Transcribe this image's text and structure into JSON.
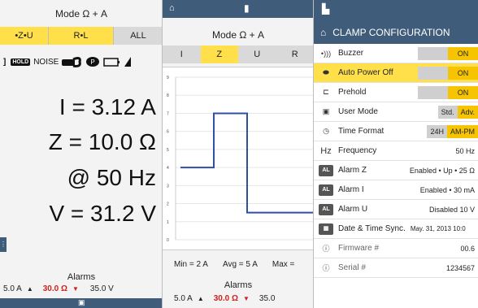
{
  "screen1": {
    "mode": "Mode  Ω + A",
    "tabs": [
      "•Z•U",
      "R•L",
      "ALL"
    ],
    "indicators": {
      "hold": "HOLD",
      "noise": "NOISE"
    },
    "measurements": [
      {
        "text": "I = 3.12 A"
      },
      {
        "text": "Z = 10.0 Ω"
      },
      {
        "text": "@  50 Hz"
      },
      {
        "text": "V =  31.2 V"
      }
    ],
    "alarms_label": "Alarms",
    "alarms": {
      "left": "5.0 A",
      "mid": "30.0 Ω",
      "right": "35.0 V"
    }
  },
  "screen2": {
    "mode": "Mode  Ω + A",
    "tabs": [
      "I",
      "Z",
      "U",
      "R"
    ],
    "stats": {
      "min": "Min = 2 A",
      "avg": "Avg = 5 A",
      "max": "Max ="
    },
    "alarms_label": "Alarms",
    "alarms": {
      "left": "5.0 A",
      "mid": "30.0 Ω",
      "right": "35.0"
    },
    "y_ticks": [
      "0",
      "1",
      "2",
      "3",
      "4",
      "5",
      "6",
      "7",
      "8",
      "9"
    ]
  },
  "chart_data": {
    "type": "line",
    "ylim": [
      0,
      9
    ],
    "x": [
      0,
      1,
      1,
      2,
      2,
      4
    ],
    "y": [
      4,
      4,
      7,
      7,
      1.5,
      1.5
    ]
  },
  "screen3": {
    "title": "CLAMP CONFIGURATION",
    "rows": [
      {
        "label": "Buzzer",
        "value": "ON"
      },
      {
        "label": "Auto Power Off",
        "value": "ON"
      },
      {
        "label": "Prehold",
        "value": "ON"
      },
      {
        "label": "User Mode",
        "opt1": "Std.",
        "opt2": "Adv."
      },
      {
        "label": "Time Format",
        "opt1": "24H",
        "opt2": "AM-PM"
      },
      {
        "label": "Frequency",
        "value": "50 Hz"
      },
      {
        "label": "Alarm Z",
        "value": "Enabled • Up • 25 Ω"
      },
      {
        "label": "Alarm I",
        "value": "Enabled • 30 mA"
      },
      {
        "label": "Alarm U",
        "value": "Disabled 10 V"
      },
      {
        "label": "Date & Time Sync.",
        "value": "May. 31, 2013 10:0"
      },
      {
        "label": "Firmware #",
        "value": "00.6"
      },
      {
        "label": "Serial #",
        "value": "1234567"
      }
    ],
    "icons": {
      "frequency": "Hz",
      "alarm": "AL"
    }
  },
  "colors": {
    "accent_yellow": "#ffe04a",
    "toggle_yellow": "#f6c400",
    "bar_blue": "#3f5d7a",
    "trace_blue": "#2f4fa0",
    "alarm_red": "#d01f1f"
  }
}
